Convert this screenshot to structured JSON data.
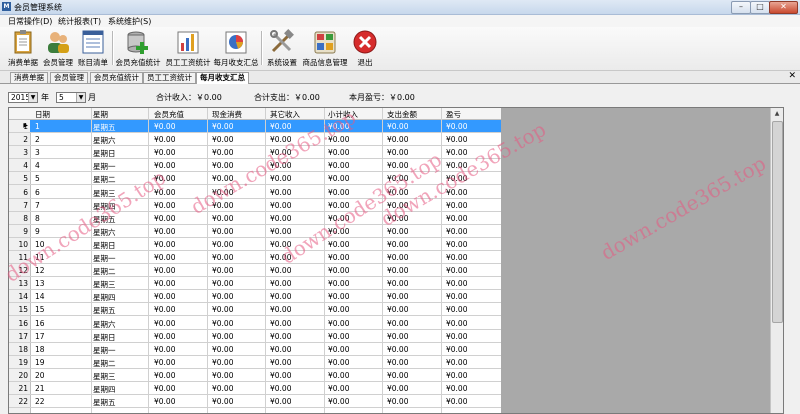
{
  "window": {
    "title": "会员管理系统",
    "icon_label": "M"
  },
  "menu": [
    "日常操作(D)",
    "统计报表(T)",
    "系统维护(S)"
  ],
  "toolbar": [
    {
      "label": "消费单据",
      "icon": "clipboard-icon"
    },
    {
      "label": "会员管理",
      "icon": "members-icon"
    },
    {
      "label": "账目清单",
      "icon": "ledger-icon"
    },
    {
      "label": "会员充值统计",
      "icon": "database-add-icon"
    },
    {
      "label": "员工工资统计",
      "icon": "bar-chart-icon"
    },
    {
      "label": "每月收支汇总",
      "icon": "pie-chart-icon"
    },
    {
      "label": "系统设置",
      "icon": "tools-icon"
    },
    {
      "label": "商品信息管理",
      "icon": "calculator-icon"
    },
    {
      "label": "退出",
      "icon": "exit-icon"
    }
  ],
  "tabs": [
    "消费单据",
    "会员管理",
    "会员充值统计",
    "员工工资统计",
    "每月收支汇总"
  ],
  "active_tab": 4,
  "filter": {
    "year": "2015",
    "year_label": "年",
    "month": "5",
    "month_label": "月",
    "total_income": "合计收入：￥0.00",
    "total_expense": "合计支出：￥0.00",
    "month_profit": "本月盈亏：￥0.00"
  },
  "table": {
    "columns": [
      "日期",
      "星期",
      "会员充值",
      "现金消费",
      "其它收入",
      "小计收入",
      "支出金额",
      "盈亏"
    ],
    "rows": [
      [
        "1",
        "星期五",
        "¥0.00",
        "¥0.00",
        "¥0.00",
        "¥0.00",
        "¥0.00",
        "¥0.00"
      ],
      [
        "2",
        "星期六",
        "¥0.00",
        "¥0.00",
        "¥0.00",
        "¥0.00",
        "¥0.00",
        "¥0.00"
      ],
      [
        "3",
        "星期日",
        "¥0.00",
        "¥0.00",
        "¥0.00",
        "¥0.00",
        "¥0.00",
        "¥0.00"
      ],
      [
        "4",
        "星期一",
        "¥0.00",
        "¥0.00",
        "¥0.00",
        "¥0.00",
        "¥0.00",
        "¥0.00"
      ],
      [
        "5",
        "星期二",
        "¥0.00",
        "¥0.00",
        "¥0.00",
        "¥0.00",
        "¥0.00",
        "¥0.00"
      ],
      [
        "6",
        "星期三",
        "¥0.00",
        "¥0.00",
        "¥0.00",
        "¥0.00",
        "¥0.00",
        "¥0.00"
      ],
      [
        "7",
        "星期四",
        "¥0.00",
        "¥0.00",
        "¥0.00",
        "¥0.00",
        "¥0.00",
        "¥0.00"
      ],
      [
        "8",
        "星期五",
        "¥0.00",
        "¥0.00",
        "¥0.00",
        "¥0.00",
        "¥0.00",
        "¥0.00"
      ],
      [
        "9",
        "星期六",
        "¥0.00",
        "¥0.00",
        "¥0.00",
        "¥0.00",
        "¥0.00",
        "¥0.00"
      ],
      [
        "10",
        "星期日",
        "¥0.00",
        "¥0.00",
        "¥0.00",
        "¥0.00",
        "¥0.00",
        "¥0.00"
      ],
      [
        "11",
        "星期一",
        "¥0.00",
        "¥0.00",
        "¥0.00",
        "¥0.00",
        "¥0.00",
        "¥0.00"
      ],
      [
        "12",
        "星期二",
        "¥0.00",
        "¥0.00",
        "¥0.00",
        "¥0.00",
        "¥0.00",
        "¥0.00"
      ],
      [
        "13",
        "星期三",
        "¥0.00",
        "¥0.00",
        "¥0.00",
        "¥0.00",
        "¥0.00",
        "¥0.00"
      ],
      [
        "14",
        "星期四",
        "¥0.00",
        "¥0.00",
        "¥0.00",
        "¥0.00",
        "¥0.00",
        "¥0.00"
      ],
      [
        "15",
        "星期五",
        "¥0.00",
        "¥0.00",
        "¥0.00",
        "¥0.00",
        "¥0.00",
        "¥0.00"
      ],
      [
        "16",
        "星期六",
        "¥0.00",
        "¥0.00",
        "¥0.00",
        "¥0.00",
        "¥0.00",
        "¥0.00"
      ],
      [
        "17",
        "星期日",
        "¥0.00",
        "¥0.00",
        "¥0.00",
        "¥0.00",
        "¥0.00",
        "¥0.00"
      ],
      [
        "18",
        "星期一",
        "¥0.00",
        "¥0.00",
        "¥0.00",
        "¥0.00",
        "¥0.00",
        "¥0.00"
      ],
      [
        "19",
        "星期二",
        "¥0.00",
        "¥0.00",
        "¥0.00",
        "¥0.00",
        "¥0.00",
        "¥0.00"
      ],
      [
        "20",
        "星期三",
        "¥0.00",
        "¥0.00",
        "¥0.00",
        "¥0.00",
        "¥0.00",
        "¥0.00"
      ],
      [
        "21",
        "星期四",
        "¥0.00",
        "¥0.00",
        "¥0.00",
        "¥0.00",
        "¥0.00",
        "¥0.00"
      ],
      [
        "22",
        "星期五",
        "¥0.00",
        "¥0.00",
        "¥0.00",
        "¥0.00",
        "¥0.00",
        "¥0.00"
      ]
    ],
    "selected_row": 0
  },
  "watermarks": [
    "down.code365.top",
    "down.code365.top",
    "down.code365.top",
    "down.code365.top",
    "down.code365.top"
  ],
  "colors": {
    "selection": "#3399ff",
    "grid_empty": "#a9a9a9",
    "watermark": "#e65a82"
  }
}
